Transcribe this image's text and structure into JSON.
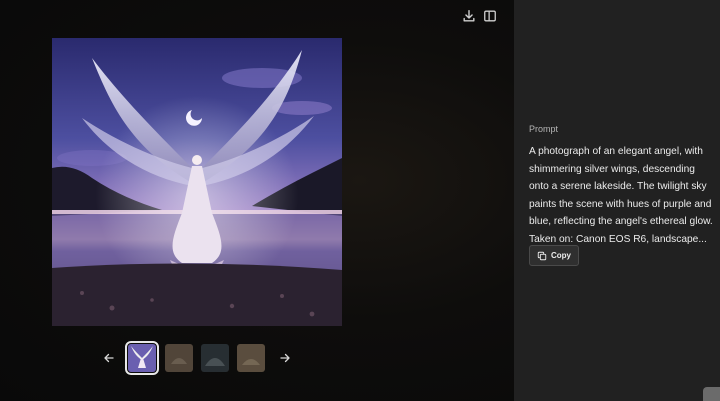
{
  "toolbar": {
    "download_icon": "download-icon",
    "sidebar_toggle_icon": "sidebar-toggle-icon"
  },
  "gallery": {
    "main_image_description_icon": "angel-over-lake-image",
    "thumbnails": [
      {
        "name": "thumbnail-1",
        "selected": true
      },
      {
        "name": "thumbnail-2",
        "selected": false
      },
      {
        "name": "thumbnail-3",
        "selected": false
      },
      {
        "name": "thumbnail-4",
        "selected": false
      }
    ],
    "prev_icon": "arrow-left-icon",
    "next_icon": "arrow-right-icon"
  },
  "sidebar": {
    "label": "Prompt",
    "prompt_text": "A photograph of an elegant angel, with shimmering silver wings, descending onto a serene lakeside. The twilight sky paints the scene with hues of purple and blue, reflecting the angel's ethereal glow. Taken on: Canon EOS R6, landscape...",
    "copy_label": "Copy",
    "copy_icon": "copy-icon"
  },
  "colors": {
    "sidebar_bg": "#212121",
    "viewer_bg": "#0b0b0b",
    "text_primary": "#ececec",
    "text_secondary": "#b4b4b4"
  }
}
